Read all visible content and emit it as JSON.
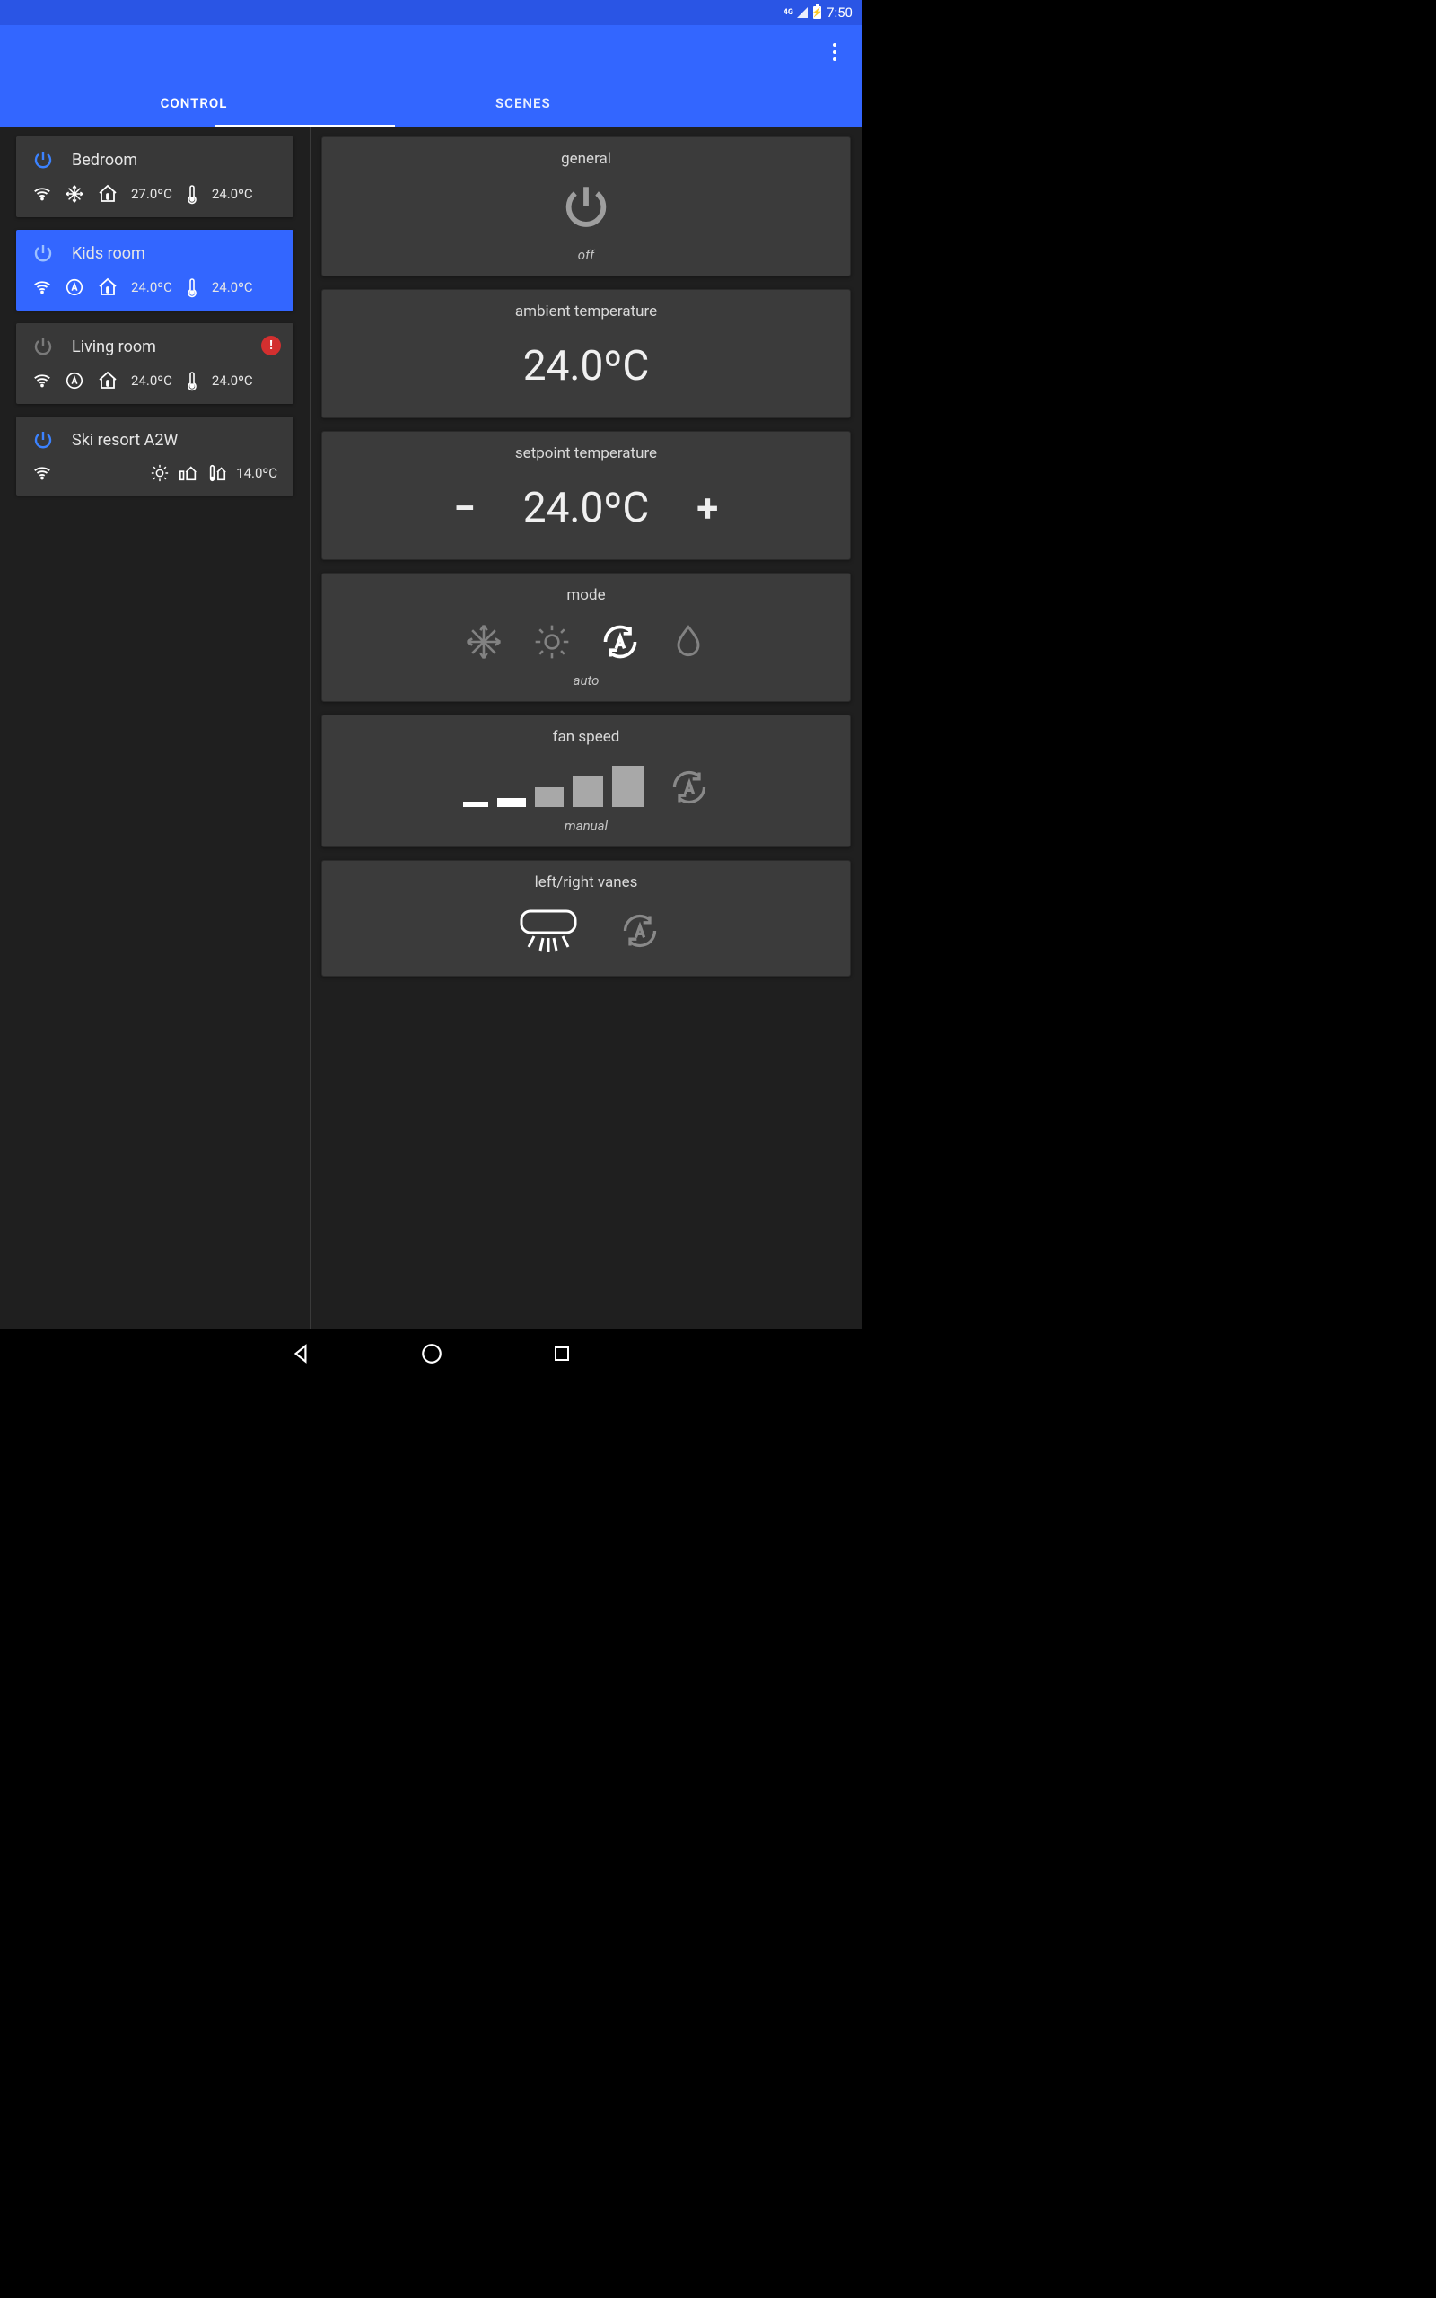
{
  "status": {
    "network": "4G",
    "time": "7:50"
  },
  "tabs": {
    "control": "CONTROL",
    "scenes": "SCENES",
    "active": "control"
  },
  "rooms": [
    {
      "name": "Bedroom",
      "power": "on",
      "mode": "cool",
      "setpoint": "27.0ºC",
      "ambient": "24.0ºC",
      "selected": false,
      "alert": false
    },
    {
      "name": "Kids room",
      "power": "on",
      "mode": "auto",
      "setpoint": "24.0ºC",
      "ambient": "24.0ºC",
      "selected": true,
      "alert": false
    },
    {
      "name": "Living room",
      "power": "off",
      "mode": "auto",
      "setpoint": "24.0ºC",
      "ambient": "24.0ºC",
      "selected": false,
      "alert": true
    },
    {
      "name": "Ski resort A2W",
      "power": "on",
      "mode": "heat",
      "setpoint": "",
      "ambient": "14.0ºC",
      "selected": false,
      "alert": false,
      "a2w": true
    }
  ],
  "panel": {
    "general": {
      "title": "general",
      "state": "off"
    },
    "ambient": {
      "title": "ambient temperature",
      "value": "24.0ºC"
    },
    "setpoint": {
      "title": "setpoint temperature",
      "value": "24.0ºC"
    },
    "mode": {
      "title": "mode",
      "state": "auto"
    },
    "fan": {
      "title": "fan speed",
      "state": "manual"
    },
    "vanes": {
      "title": "left/right vanes"
    }
  }
}
